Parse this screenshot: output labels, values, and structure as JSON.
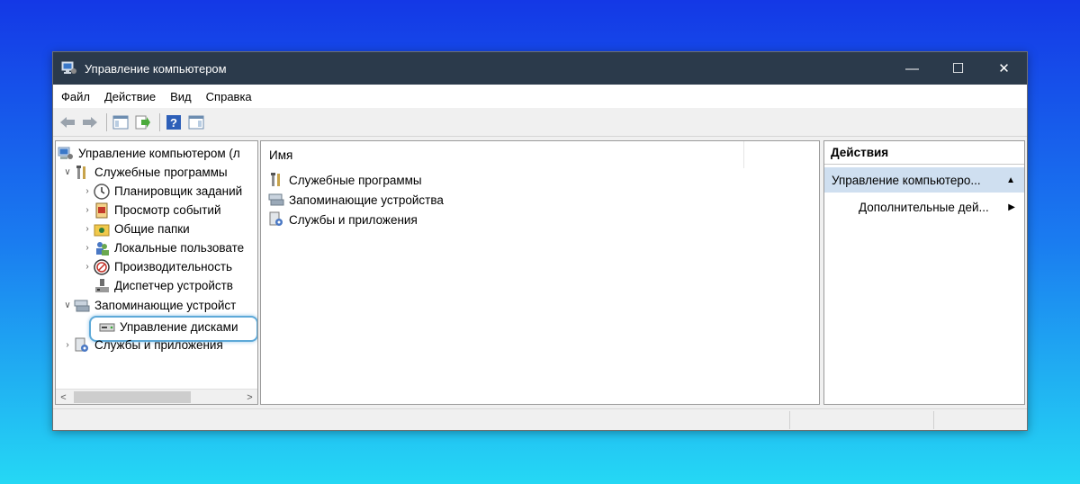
{
  "window": {
    "title": "Управление компьютером",
    "controls": {
      "minimize": "—",
      "maximize": "☐",
      "close": "✕"
    }
  },
  "menu": {
    "items": [
      {
        "label": "Файл"
      },
      {
        "label": "Действие"
      },
      {
        "label": "Вид"
      },
      {
        "label": "Справка"
      }
    ]
  },
  "toolbar": {
    "buttons": [
      "back-icon",
      "forward-icon",
      "console-tree-icon",
      "export-list-icon",
      "help-icon",
      "action-pane-icon"
    ]
  },
  "tree": {
    "root": "Управление компьютером (л",
    "items": [
      {
        "label": "Служебные программы",
        "icon": "tools-icon",
        "state": "expanded"
      },
      {
        "label": "Планировщик заданий",
        "icon": "clock-icon",
        "state": "collapsed"
      },
      {
        "label": "Просмотр событий",
        "icon": "event-viewer-icon",
        "state": "collapsed"
      },
      {
        "label": "Общие папки",
        "icon": "shared-folder-icon",
        "state": "collapsed"
      },
      {
        "label": "Локальные пользовате",
        "icon": "users-icon",
        "state": "collapsed"
      },
      {
        "label": "Производительность",
        "icon": "performance-icon",
        "state": "collapsed"
      },
      {
        "label": "Диспетчер устройств",
        "icon": "device-manager-icon",
        "state": "none"
      },
      {
        "label": "Запоминающие устройст",
        "icon": "storage-icon",
        "state": "expanded"
      },
      {
        "label": "Управление дисками",
        "icon": "disk-icon",
        "state": "none"
      },
      {
        "label": "Службы и приложения",
        "icon": "services-icon",
        "state": "collapsed"
      }
    ]
  },
  "list": {
    "column_name": "Имя",
    "rows": [
      {
        "label": "Служебные программы",
        "icon": "tools-icon"
      },
      {
        "label": "Запоминающие устройства",
        "icon": "storage-icon"
      },
      {
        "label": "Службы и приложения",
        "icon": "services-icon"
      }
    ]
  },
  "actions": {
    "header": "Действия",
    "main_item": "Управление компьютеро...",
    "sub_item": "Дополнительные дей..."
  },
  "colors": {
    "titlebar": "#2b3a4b",
    "highlight_ring": "#5da9d8",
    "action_selected": "#cfdff0"
  }
}
